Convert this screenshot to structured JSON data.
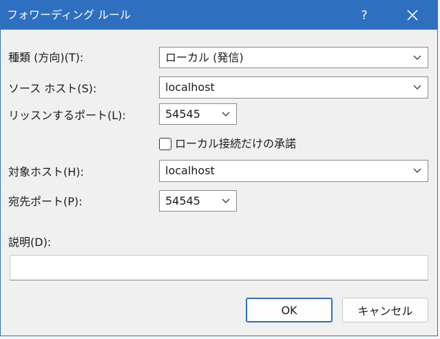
{
  "window": {
    "title": "フォワーディング ルール",
    "help_label": "?",
    "close_icon": "close-icon"
  },
  "form": {
    "type": {
      "label": "種類 (方向)(T):",
      "value": "ローカル (発信)"
    },
    "source_host": {
      "label": "ソース ホスト(S):",
      "value": "localhost"
    },
    "listen_port": {
      "label": "リッスンするポート(L):",
      "value": "54545"
    },
    "local_only": {
      "label": "ローカル接続だけの承諾",
      "checked": false
    },
    "target_host": {
      "label": "対象ホスト(H):",
      "value": "localhost"
    },
    "dest_port": {
      "label": "宛先ポート(P):",
      "value": "54545"
    },
    "description": {
      "label": "説明(D):",
      "value": ""
    }
  },
  "buttons": {
    "ok": "OK",
    "cancel": "キャンセル"
  },
  "colors": {
    "titlebar": "#2f6fbf",
    "background": "#f0f0f0",
    "accent_border": "#2f6fbf"
  }
}
